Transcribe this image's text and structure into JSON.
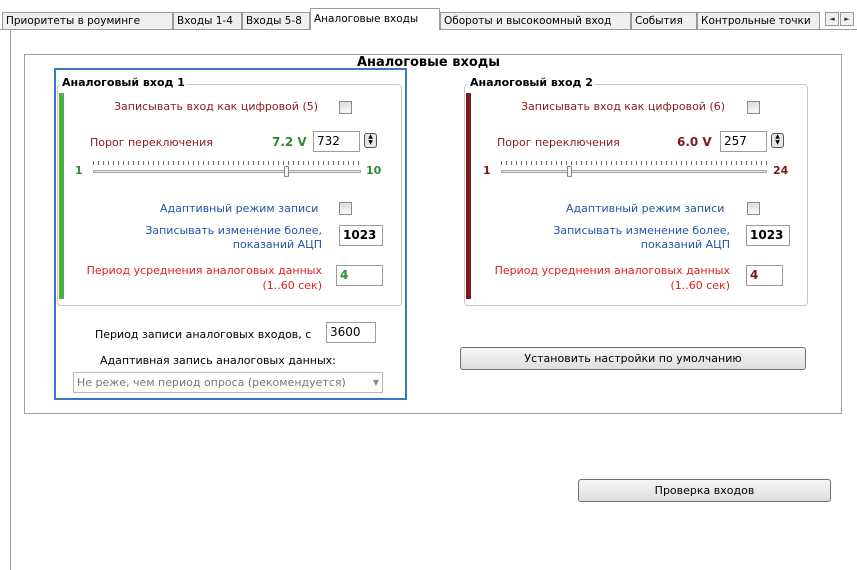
{
  "tabs": [
    {
      "label": "Приоритеты в роуминге",
      "active": false
    },
    {
      "label": "Входы 1-4",
      "active": false
    },
    {
      "label": "Входы 5-8",
      "active": false
    },
    {
      "label": "Аналоговые входы",
      "active": true
    },
    {
      "label": "Обороты и высокоомный вход",
      "active": false
    },
    {
      "label": "События",
      "active": false
    },
    {
      "label": "Контрольные точки",
      "active": false
    }
  ],
  "tab_scroll": {
    "left_icon": "◄",
    "right_icon": "►"
  },
  "group_title": "Аналоговые входы",
  "input1": {
    "title": "Аналоговый вход 1",
    "accent_color": "#4caf3d",
    "record_digital_label": "Записывать вход как цифровой (5)",
    "threshold_label": "Порог переключения",
    "threshold_voltage": "7.2 V",
    "threshold_value": "732",
    "slider_min": "1",
    "slider_max": "10",
    "slider_level": 0.72,
    "adaptive_label": "Адаптивный режим записи",
    "change_label_1": "Записывать изменение более,",
    "change_label_2": "показаний АЦП",
    "change_value": "1023",
    "avg_label_1": "Период усреднения аналоговых данных",
    "avg_label_2": "(1..60 сек)",
    "avg_value": "4"
  },
  "input2": {
    "title": "Аналоговый вход 2",
    "accent_color": "#7b1a1a",
    "record_digital_label": "Записывать вход как цифровой (6)",
    "threshold_label": "Порог переключения",
    "threshold_voltage": "6.0 V",
    "threshold_value": "257",
    "slider_min": "1",
    "slider_max": "24",
    "slider_level": 0.257,
    "adaptive_label": "Адаптивный режим записи",
    "change_label_1": "Записывать изменение более,",
    "change_label_2": "показаний АЦП",
    "change_value": "1023",
    "avg_label_1": "Период усреднения аналоговых данных",
    "avg_label_2": "(1..60 сек)",
    "avg_value": "4"
  },
  "record_period_label": "Период записи аналоговых входов, с",
  "record_period_value": "3600",
  "adaptive_data_label": "Адаптивная запись аналоговых данных:",
  "adaptive_data_option": "Не реже, чем период опроса (рекомендуется)",
  "default_button": "Установить настройки по умолчанию",
  "check_inputs_button": "Проверка входов",
  "colors": {
    "green_value": "#2e8b2e",
    "dark_red_value": "#7b1a1a",
    "selection_border": "#3a78c6"
  }
}
